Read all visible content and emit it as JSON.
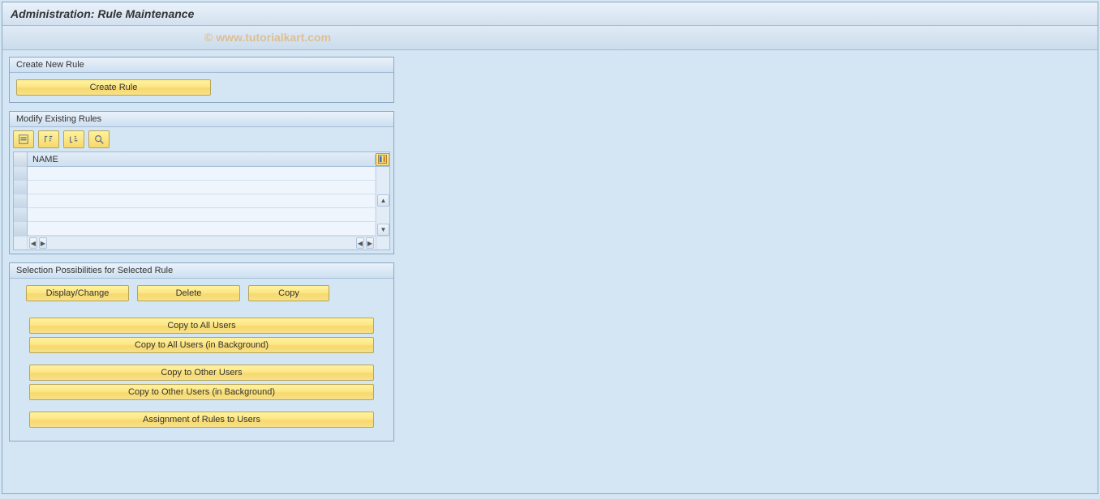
{
  "title": "Administration: Rule Maintenance",
  "watermark": "© www.tutorialkart.com",
  "panels": {
    "create": {
      "header": "Create New Rule",
      "create_btn": "Create Rule"
    },
    "modify": {
      "header": "Modify Existing Rules",
      "column_name": "NAME",
      "toolbar_icons": [
        "details-icon",
        "sort-asc-icon",
        "sort-desc-icon",
        "find-icon"
      ]
    },
    "selection": {
      "header": "Selection Possibilities for Selected Rule",
      "display_change": "Display/Change",
      "delete": "Delete",
      "copy": "Copy",
      "copy_all": "Copy to All Users",
      "copy_all_bg": "Copy to All Users (in Background)",
      "copy_other": "Copy to Other Users",
      "copy_other_bg": "Copy to Other Users (in Background)",
      "assignment": "Assignment of Rules to Users"
    }
  }
}
